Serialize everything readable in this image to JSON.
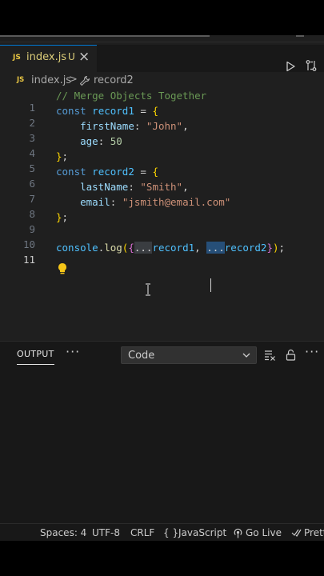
{
  "tab": {
    "icon": "JS",
    "filename": "index.js",
    "modified_flag": "U",
    "close": "×"
  },
  "breadcrumb": {
    "icon": "JS",
    "file": "index.js",
    "separator": ">",
    "symbol": "record2"
  },
  "editor": {
    "active_line": 11,
    "lines": [
      {
        "num": "1"
      },
      {
        "num": "2"
      },
      {
        "num": "3"
      },
      {
        "num": "4"
      },
      {
        "num": "5"
      },
      {
        "num": "6"
      },
      {
        "num": "7"
      },
      {
        "num": "8"
      },
      {
        "num": "9"
      },
      {
        "num": "10"
      },
      {
        "num": "11"
      }
    ],
    "code": {
      "l1_comment": "// Merge Objects Together",
      "kw_const": "const",
      "record1": "record1",
      "record2": "record2",
      "eq": " = ",
      "open_brace": "{",
      "close_brace": "}",
      "semicolon": ";",
      "firstName": "firstName",
      "john": "\"John\"",
      "age": "age",
      "age_val": "50",
      "lastName": "lastName",
      "smith": "\"Smith\"",
      "email": "email",
      "email_val": "\"jsmith@email.com\"",
      "colon": ": ",
      "comma": ",",
      "console": "console",
      "log": "log",
      "spread": "...",
      "rec1_arg": "record1",
      "rec2_arg": "record2"
    }
  },
  "panel": {
    "tab_label": "OUTPUT",
    "more": "···",
    "channel_value": "Code"
  },
  "statusbar": {
    "spaces": "Spaces: 4",
    "encoding": "UTF-8",
    "eol": "CRLF",
    "language_icon": "{ }",
    "language": "JavaScript",
    "golive": "Go Live",
    "prettier": "Prett"
  },
  "colors": {
    "accent": "#0078d4",
    "editor_bg": "#1f1f1f",
    "panel_bg": "#181818"
  }
}
